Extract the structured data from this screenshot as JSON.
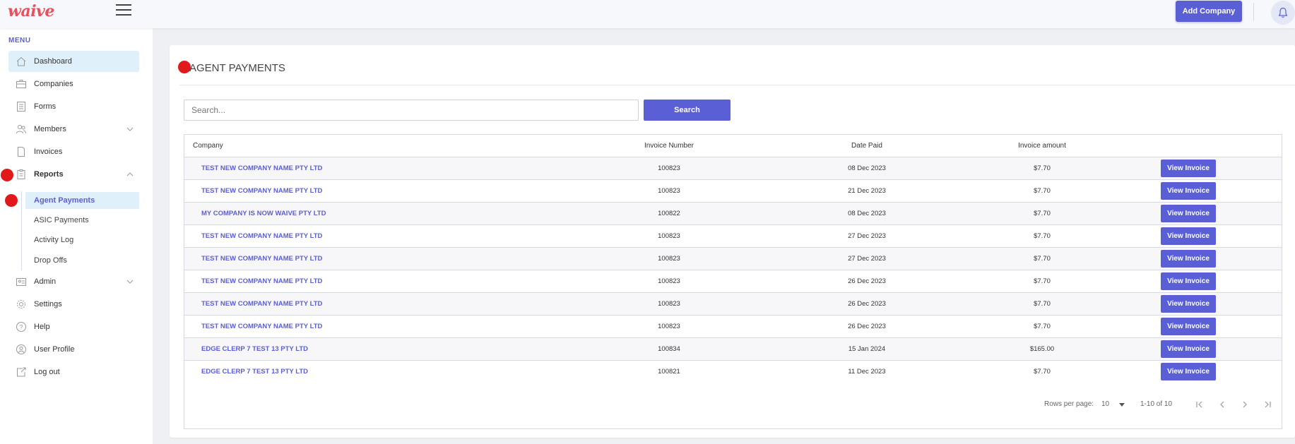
{
  "app": {
    "logo_text": "waive"
  },
  "header": {
    "add_company_label": "Add Company"
  },
  "sidebar": {
    "menu_title": "MENU",
    "items": [
      {
        "label": "Dashboard",
        "icon": "home-icon"
      },
      {
        "label": "Companies",
        "icon": "briefcase-icon"
      },
      {
        "label": "Forms",
        "icon": "forms-icon"
      },
      {
        "label": "Members",
        "icon": "members-icon"
      },
      {
        "label": "Invoices",
        "icon": "document-icon"
      },
      {
        "label": "Reports",
        "icon": "clipboard-icon"
      },
      {
        "label": "Admin",
        "icon": "admin-icon"
      },
      {
        "label": "Settings",
        "icon": "gear-icon"
      },
      {
        "label": "Help",
        "icon": "help-icon"
      },
      {
        "label": "User Profile",
        "icon": "user-profile-icon"
      },
      {
        "label": "Log out",
        "icon": "logout-icon"
      }
    ],
    "report_subitems": [
      {
        "label": "Agent Payments"
      },
      {
        "label": "ASIC Payments"
      },
      {
        "label": "Activity Log"
      },
      {
        "label": "Drop Offs"
      }
    ]
  },
  "main": {
    "title": "AGENT PAYMENTS",
    "search": {
      "placeholder": "Search...",
      "button_label": "Search"
    },
    "table": {
      "columns": [
        "Company",
        "Invoice Number",
        "Date Paid",
        "Invoice amount"
      ],
      "action_label": "View Invoice",
      "rows": [
        {
          "company": "TEST NEW COMPANY NAME PTY LTD",
          "invoice": "100823",
          "date": "08 Dec 2023",
          "amount": "$7.70"
        },
        {
          "company": "TEST NEW COMPANY NAME PTY LTD",
          "invoice": "100823",
          "date": "21 Dec 2023",
          "amount": "$7.70"
        },
        {
          "company": "MY COMPANY IS NOW WAIVE PTY LTD",
          "invoice": "100822",
          "date": "08 Dec 2023",
          "amount": "$7.70"
        },
        {
          "company": "TEST NEW COMPANY NAME PTY LTD",
          "invoice": "100823",
          "date": "27 Dec 2023",
          "amount": "$7.70"
        },
        {
          "company": "TEST NEW COMPANY NAME PTY LTD",
          "invoice": "100823",
          "date": "27 Dec 2023",
          "amount": "$7.70"
        },
        {
          "company": "TEST NEW COMPANY NAME PTY LTD",
          "invoice": "100823",
          "date": "26 Dec 2023",
          "amount": "$7.70"
        },
        {
          "company": "TEST NEW COMPANY NAME PTY LTD",
          "invoice": "100823",
          "date": "26 Dec 2023",
          "amount": "$7.70"
        },
        {
          "company": "TEST NEW COMPANY NAME PTY LTD",
          "invoice": "100823",
          "date": "26 Dec 2023",
          "amount": "$7.70"
        },
        {
          "company": "EDGE CLERP 7 TEST 13 PTY LTD",
          "invoice": "100834",
          "date": "15 Jan 2024",
          "amount": "$165.00"
        },
        {
          "company": "EDGE CLERP 7 TEST 13 PTY LTD",
          "invoice": "100821",
          "date": "11 Dec 2023",
          "amount": "$7.70"
        }
      ]
    },
    "pagination": {
      "rows_per_page_label": "Rows per page:",
      "rows_per_page_value": "10",
      "range_text": "1-10 of 10"
    }
  },
  "colors": {
    "accent": "#5a5fd6",
    "logo": "#e8505b",
    "active_bg": "#e0f0fb",
    "marker": "#e01a1a"
  }
}
